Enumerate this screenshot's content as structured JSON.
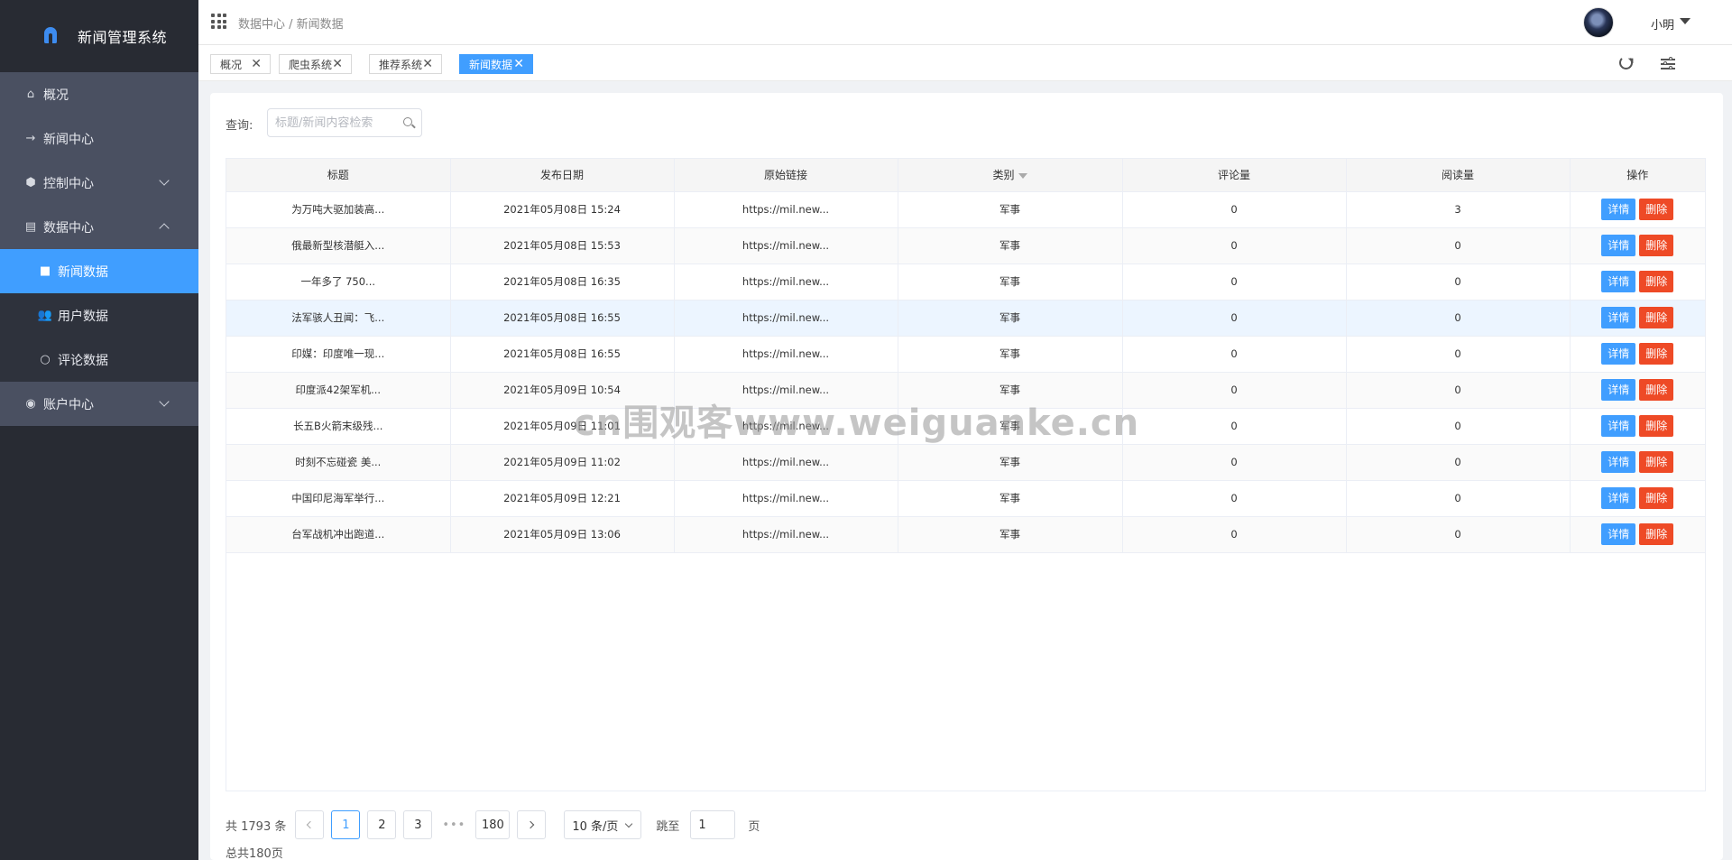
{
  "app": {
    "title": "新闻管理系统"
  },
  "sidebar": {
    "items": [
      {
        "label": "概况",
        "icon": "home-icon"
      },
      {
        "label": "新闻中心",
        "icon": "arrow-right-icon"
      },
      {
        "label": "控制中心",
        "icon": "cube-icon"
      },
      {
        "label": "数据中心",
        "icon": "database-icon",
        "expanded": true,
        "children": [
          {
            "label": "新闻数据",
            "icon": "table-icon",
            "active": true
          },
          {
            "label": "用户数据",
            "icon": "users-icon"
          },
          {
            "label": "评论数据",
            "icon": "comment-icon"
          }
        ]
      },
      {
        "label": "账户中心",
        "icon": "user-circle-icon"
      }
    ]
  },
  "header": {
    "breadcrumb": "数据中心 / 新闻数据",
    "username": "小明"
  },
  "tags": [
    {
      "label": "概况"
    },
    {
      "label": "爬虫系统"
    },
    {
      "label": "推荐系统"
    },
    {
      "label": "新闻数据",
      "active": true
    }
  ],
  "search": {
    "label": "查询:",
    "placeholder": "标题/新闻内容检索"
  },
  "table": {
    "columns": [
      "标题",
      "发布日期",
      "原始链接",
      "类别",
      "评论量",
      "阅读量",
      "操作"
    ],
    "rows": [
      [
        "为万吨大驱加装高...",
        "2021年05月08日 15:24",
        "https://mil.new...",
        "军事",
        "0",
        "3"
      ],
      [
        "俄最新型核潜艇入...",
        "2021年05月08日 15:53",
        "https://mil.new...",
        "军事",
        "0",
        "0"
      ],
      [
        "一年多了 750...",
        "2021年05月08日 16:35",
        "https://mil.new...",
        "军事",
        "0",
        "0"
      ],
      [
        "法军骇人丑闻：飞...",
        "2021年05月08日 16:55",
        "https://mil.new...",
        "军事",
        "0",
        "0"
      ],
      [
        "印媒：印度唯一现...",
        "2021年05月08日 16:55",
        "https://mil.new...",
        "军事",
        "0",
        "0"
      ],
      [
        "印度派42架军机...",
        "2021年05月09日 10:54",
        "https://mil.new...",
        "军事",
        "0",
        "0"
      ],
      [
        "长五B火箭末级残...",
        "2021年05月09日 11:01",
        "https://mil.new...",
        "军事",
        "0",
        "0"
      ],
      [
        "时刻不忘碰瓷 美...",
        "2021年05月09日 11:02",
        "https://mil.new...",
        "军事",
        "0",
        "0"
      ],
      [
        "中国印尼海军举行...",
        "2021年05月09日 12:21",
        "https://mil.new...",
        "军事",
        "0",
        "0"
      ],
      [
        "台军战机冲出跑道...",
        "2021年05月09日 13:06",
        "https://mil.new...",
        "军事",
        "0",
        "0"
      ]
    ],
    "actions": {
      "detail": "详情",
      "delete": "删除"
    }
  },
  "pagination": {
    "total": "共 1793 条",
    "pages": [
      "1",
      "2",
      "3"
    ],
    "ellipsis": "•••",
    "last_page": "180",
    "page_size": "10 条/页",
    "jump_label": "跳至",
    "jump_value": "1",
    "page_unit": "页",
    "total_pages": "总共180页"
  },
  "watermark": "cn围观客www.weiguanke.cn",
  "colors": {
    "primary": "#409eff",
    "danger": "#ee4a26",
    "sidebar": "#282b33"
  }
}
